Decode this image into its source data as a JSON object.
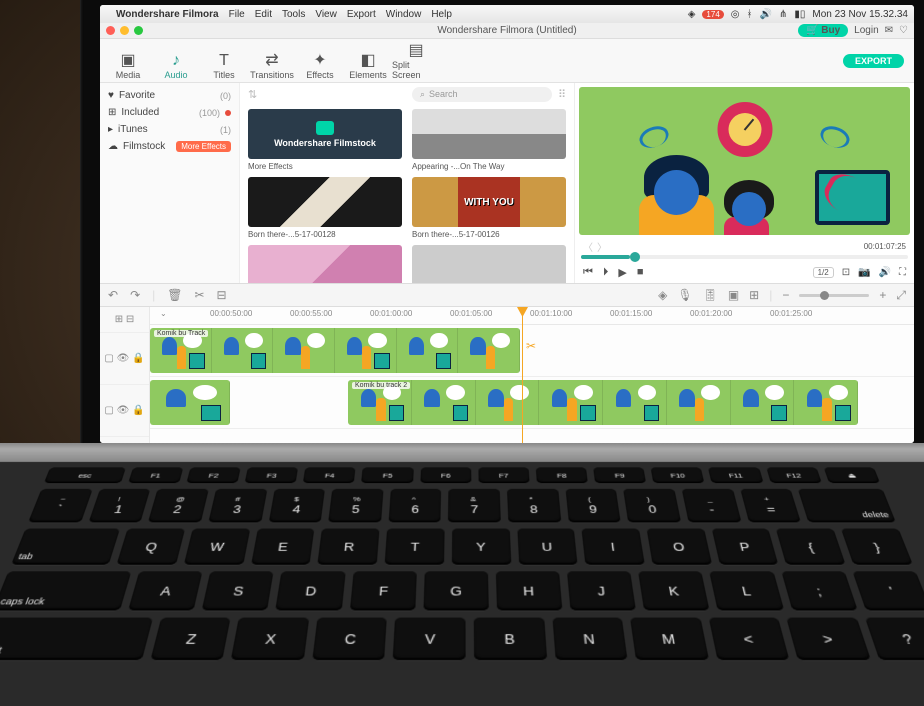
{
  "macbar": {
    "app_name": "Wondershare Filmora",
    "menus": [
      "File",
      "Edit",
      "Tools",
      "View",
      "Export",
      "Window",
      "Help"
    ],
    "status_count": "174",
    "datetime": "Mon 23 Nov  15.32.34"
  },
  "window": {
    "title": "Wondershare Filmora (Untitled)",
    "buy": "Buy",
    "login": "Login"
  },
  "ribbon": {
    "tabs": [
      {
        "label": "Media",
        "icon": "▣"
      },
      {
        "label": "Audio",
        "icon": "♪",
        "active": true
      },
      {
        "label": "Titles",
        "icon": "T"
      },
      {
        "label": "Transitions",
        "icon": "⇄"
      },
      {
        "label": "Effects",
        "icon": "✦"
      },
      {
        "label": "Elements",
        "icon": "◧"
      },
      {
        "label": "Split Screen",
        "icon": "▤"
      }
    ],
    "export": "EXPORT"
  },
  "library": {
    "items": [
      {
        "label": "Favorite",
        "count": "(0)",
        "icon": "♥"
      },
      {
        "label": "Included",
        "count": "(100)",
        "icon": "⊞",
        "dot": true
      },
      {
        "label": "iTunes",
        "count": "(1)",
        "icon": "▸"
      },
      {
        "label": "Filmstock",
        "icon": "☁",
        "button": "More Effects"
      }
    ]
  },
  "browser": {
    "search_placeholder": "Search",
    "thumbs": [
      {
        "name": "More Effects",
        "type": "filmstock",
        "brand": "Wondershare Filmstock"
      },
      {
        "name": "Appearing -...On The Way",
        "type": "couple"
      },
      {
        "name": "Born there-...5-17-00128",
        "type": "piano"
      },
      {
        "name": "Born there-...5-17-00126",
        "type": "withyou",
        "overlay": "WITH YOU"
      },
      {
        "name": "",
        "type": "pink"
      },
      {
        "name": "",
        "type": "grey"
      }
    ]
  },
  "preview": {
    "timecode": "00:01:07:25",
    "speed": "1/2"
  },
  "timeline": {
    "ruler": [
      "00:00:50:00",
      "00:00:55:00",
      "00:01:00:00",
      "00:01:05:00",
      "00:01:10:00",
      "00:01:15:00",
      "00:01:20:00",
      "00:01:25:00"
    ],
    "track1_label": "Komik bu Track",
    "track2_label": "Komik bu track 2"
  },
  "keyboard": {
    "fn": [
      "esc",
      "F1",
      "F2",
      "F3",
      "F4",
      "F5",
      "F6",
      "F7",
      "F8",
      "F9",
      "F10",
      "F11",
      "F12",
      "⏏"
    ],
    "nums": [
      [
        "~",
        "`"
      ],
      [
        "!",
        "1"
      ],
      [
        "@",
        "2"
      ],
      [
        "#",
        "3"
      ],
      [
        "$",
        "4"
      ],
      [
        "%",
        "5"
      ],
      [
        "^",
        "6"
      ],
      [
        "&",
        "7"
      ],
      [
        "*",
        "8"
      ],
      [
        "(",
        "9"
      ],
      [
        ")",
        "0"
      ],
      [
        "_",
        "-"
      ],
      [
        "+",
        "="
      ]
    ],
    "row_q": [
      "Q",
      "W",
      "E",
      "R",
      "T",
      "Y",
      "U",
      "I",
      "O",
      "P"
    ],
    "row_a": [
      "A",
      "S",
      "D",
      "F",
      "G",
      "H",
      "J",
      "K",
      "L"
    ],
    "row_z": [
      "Z",
      "X",
      "C",
      "V",
      "B",
      "N",
      "M"
    ],
    "tab": "tab",
    "caps": "caps lock",
    "shift": "shift",
    "del": "delete"
  }
}
